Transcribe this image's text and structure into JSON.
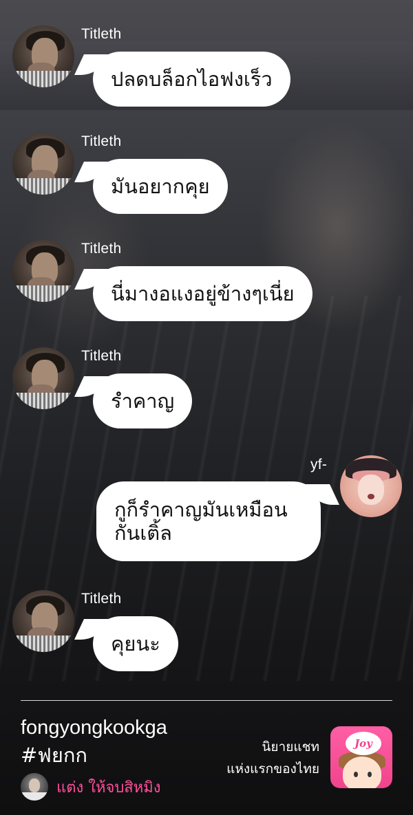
{
  "messages": [
    {
      "sender": "Titleth",
      "side": "left",
      "text": "ปลดบล็อกไอฟงเร็ว"
    },
    {
      "sender": "Titleth",
      "side": "left",
      "text": "มันอยากคุย"
    },
    {
      "sender": "Titleth",
      "side": "left",
      "text": "นี่มางอแงอยู่ข้างๆเนี่ย"
    },
    {
      "sender": "Titleth",
      "side": "left",
      "text": "รำคาญ"
    },
    {
      "sender": "yf-",
      "side": "right",
      "text_line1": "กูก็รำคาญมันเหมือน",
      "text_line2": "กันเติ้ล"
    },
    {
      "sender": "Titleth",
      "side": "left",
      "text": "คุยนะ"
    }
  ],
  "footer": {
    "story_title": "fongyongkookga",
    "hashtag": "#ฟยกก",
    "author": "แต่ง ให้จบสิหมิง",
    "tagline_line1": "นิยายแชท",
    "tagline_line2": "แห่งแรกของไทย",
    "app_logo_text": "Joy"
  },
  "colors": {
    "bubble": "#ffffff",
    "author_name": "#ff4f9a",
    "app_logo": "#f0448c",
    "divider": "#d8d8d8"
  }
}
